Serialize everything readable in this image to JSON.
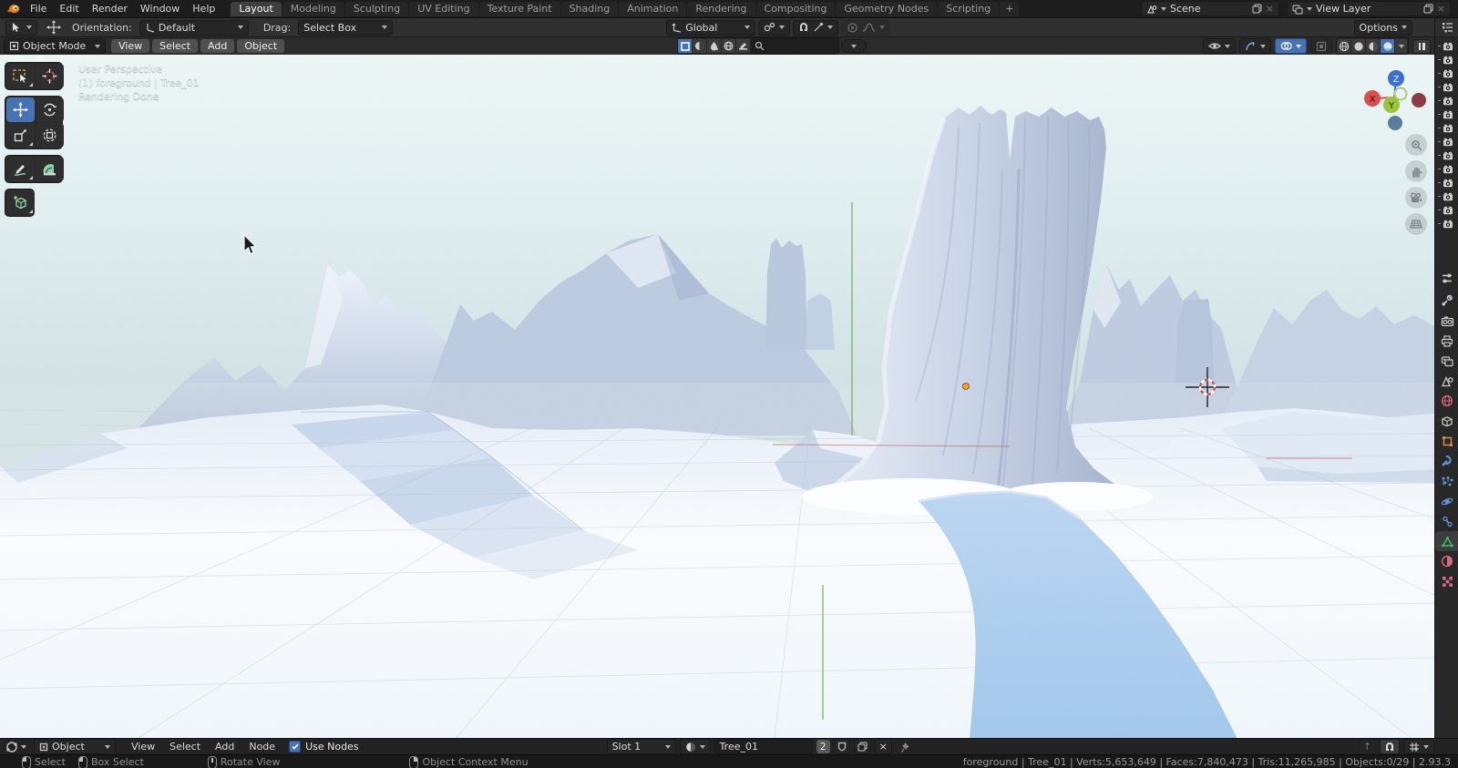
{
  "topbar": {
    "menus": [
      "File",
      "Edit",
      "Render",
      "Window",
      "Help"
    ],
    "workspaces": [
      "Layout",
      "Modeling",
      "Sculpting",
      "UV Editing",
      "Texture Paint",
      "Shading",
      "Animation",
      "Rendering",
      "Compositing",
      "Geometry Nodes",
      "Scripting"
    ],
    "active_workspace": "Layout",
    "add_tab": "+",
    "scene_selector": {
      "value": "Scene"
    },
    "view_layer_selector": {
      "value": "View Layer"
    }
  },
  "tool_settings": {
    "orientation_label": "Orientation:",
    "orientation_value": "Default",
    "drag_label": "Drag:",
    "drag_value": "Select Box",
    "transform_orientation": "Global",
    "options_label": "Options"
  },
  "viewport_header": {
    "mode": "Object Mode",
    "menus": [
      "View",
      "Select",
      "Add",
      "Object"
    ],
    "search_value": ""
  },
  "viewport": {
    "overlay": [
      "User Perspective",
      "(1) foreground | Tree_01",
      "Rendering Done"
    ],
    "axis_labels": {
      "z": "Z",
      "x": "X",
      "y": "Y"
    }
  },
  "right_panel": {
    "outliner_camera_rows": 14,
    "properties_tabs": [
      "tool",
      "render",
      "output",
      "view-layer",
      "scene",
      "world",
      "collection",
      "object",
      "modifiers",
      "particles",
      "physics",
      "constraints",
      "object-data",
      "material",
      "texture"
    ],
    "active_tab": "object-data"
  },
  "shader_editor": {
    "shader_type": "Object",
    "menus": [
      "View",
      "Select",
      "Add",
      "Node"
    ],
    "use_nodes": "Use Nodes",
    "slot": "Slot 1",
    "material_name": "Tree_01",
    "users": "2"
  },
  "status_bar": {
    "hints": [
      {
        "label": "Select"
      },
      {
        "label": "Box Select"
      },
      {
        "label": "Rotate View"
      },
      {
        "label": "Object Context Menu"
      }
    ],
    "stats": "foreground | Tree_01 | Verts:5,653,649 | Faces:7,840,473 | Tris:11,265,985 | Objects:0/29 | 2.93.3"
  },
  "icons": {
    "chevron": "▾",
    "close": "×",
    "up_arrow": "↑"
  },
  "colors": {
    "accent": "#4772b3",
    "object_orange": "#e0883f",
    "data_green": "#3fbf69",
    "material_pink": "#d6697f",
    "world_red": "#cf6679",
    "modifier_blue": "#6193d6"
  }
}
